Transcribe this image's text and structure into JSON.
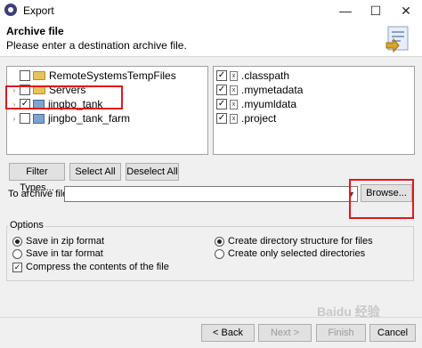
{
  "window": {
    "title": "Export",
    "minimize": "—",
    "maximize": "☐",
    "close": "✕"
  },
  "header": {
    "title": "Archive file",
    "description": "Please enter a destination archive file."
  },
  "left_tree": {
    "items": [
      {
        "label": "RemoteSystemsTempFiles",
        "checked": false,
        "icon": "folder-icon",
        "expander": ""
      },
      {
        "label": "Servers",
        "checked": false,
        "icon": "folder-icon",
        "expander": "›"
      },
      {
        "label": "jingbo_tank",
        "checked": true,
        "icon": "project-icon",
        "expander": "›"
      },
      {
        "label": "jingbo_tank_farm",
        "checked": false,
        "icon": "project-icon",
        "expander": "›"
      }
    ]
  },
  "right_list": {
    "items": [
      {
        "label": ".classpath",
        "checked": true,
        "icon": "file-icon"
      },
      {
        "label": ".mymetadata",
        "checked": true,
        "icon": "file-icon"
      },
      {
        "label": ".myumldata",
        "checked": true,
        "icon": "file-icon"
      },
      {
        "label": ".project",
        "checked": true,
        "icon": "file-icon"
      }
    ]
  },
  "selection_buttons": {
    "filter_types": "Filter Types...",
    "select_all": "Select All",
    "deselect_all": "Deselect All"
  },
  "archive": {
    "label": "To archive file:",
    "value": "",
    "browse": "Browse..."
  },
  "options": {
    "title": "Options",
    "save_zip": "Save in zip format",
    "save_tar": "Save in tar format",
    "compress": "Compress the contents of the file",
    "create_dir_structure": "Create directory structure for files",
    "create_selected_dirs": "Create only selected directories",
    "selected": {
      "format": "zip",
      "structure": "directory",
      "compress": true
    }
  },
  "footer": {
    "back": "< Back",
    "next": "Next >",
    "finish": "Finish",
    "cancel": "Cancel"
  },
  "watermark": "Baidu 经验",
  "colors": {
    "highlight": "#e0181c",
    "dialog_bg": "#f0f0f0"
  }
}
